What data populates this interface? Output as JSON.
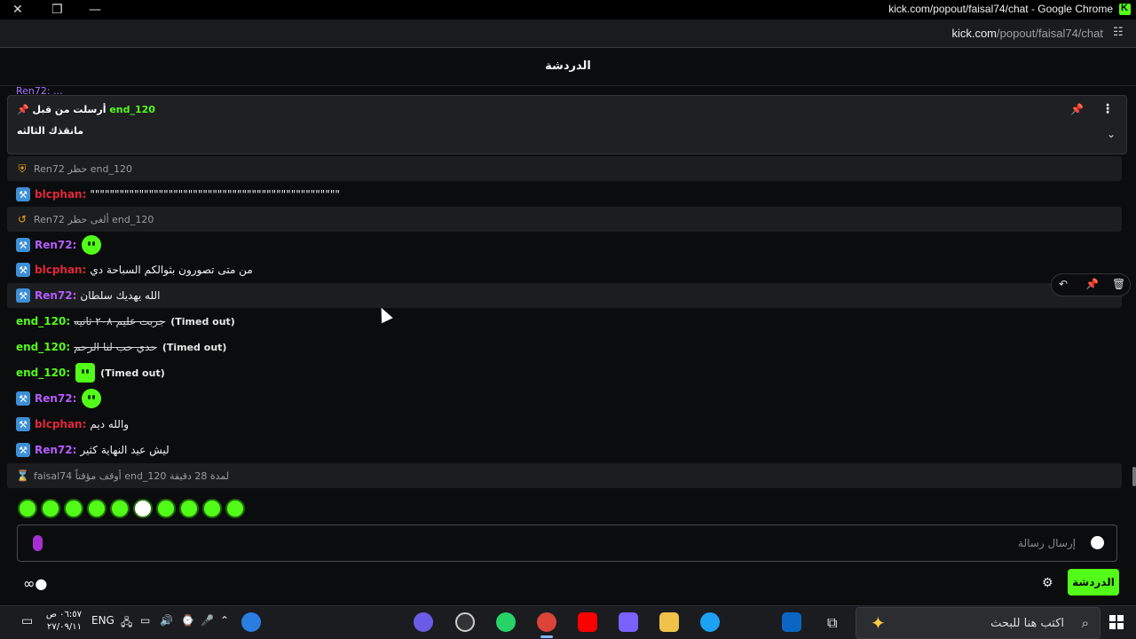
{
  "window": {
    "title": "kick.com/popout/faisal74/chat - Google Chrome",
    "controls": [
      "✕",
      "❐",
      "—"
    ]
  },
  "urlbar": {
    "host": "kick.com",
    "path": "/popout/faisal74/chat",
    "tune_icon": "☷"
  },
  "chat": {
    "title": "الدردشة",
    "peek": "Ren72: ...",
    "pinned": {
      "label": "أرسلت من قبل",
      "user": "end_120",
      "message": "مانقذك الثالثه",
      "chevron": "⌄",
      "menu": "⋮",
      "pin": "📌"
    },
    "messages": [
      {
        "user": "",
        "text": "",
        "sys": "Ren72 حظر end_120"
      },
      {
        "user": "blcphan:",
        "text": "\"\"\"\"\"\"\"\"\"\"\"\"\"\"\"\"\"\"\"\"\"\"\"\"\"\"\"\"\"\"\"\"\"\"\"\"\"\"\"\"\"\"\"\"\"\"\"\"\"\"\""
      },
      {
        "user": "",
        "text": "",
        "sys": "Ren72 ألغى حظر end_120"
      },
      {
        "user": "Ren72:",
        "text": ""
      },
      {
        "user": "blcphan:",
        "text": "من متى تصورون بثوالكم السباحة دي"
      },
      {
        "user": "Ren72:",
        "text": "الله يهديك سلطان"
      },
      {
        "user": "end_120:",
        "text": "جربت عليم ٢٠٨ ثانيه",
        "status": "(Timed out)"
      },
      {
        "user": "end_120:",
        "text": "حدي حب لنا الرحم",
        "status": "(Timed out)"
      },
      {
        "user": "end_120:",
        "text": "",
        "status": "(Timed out)"
      },
      {
        "user": "Ren72:",
        "text": ""
      },
      {
        "user": "blcphan:",
        "text": "والله ديم"
      },
      {
        "user": "Ren72:",
        "text": "ليش عيد النهاية كثير"
      },
      {
        "user": "",
        "text": "",
        "sys": "faisal74 أوقف مؤقتاً end_120 لمدة 28 دقيقة"
      }
    ],
    "hover_tools": [
      "↶",
      "📌",
      "🗑"
    ],
    "input_placeholder": "إرسال رسالة",
    "send_label": "الدردشة",
    "footer_icon": "∞●"
  },
  "taskbar": {
    "clock_time": "٠٦:٥٧ ص",
    "clock_date": "٢٧/٠٩/١١",
    "lang": "ENG",
    "search_text": "اكتب هنا للبحث",
    "search_icon": "⌕"
  },
  "colors": {
    "accent": "#53fc18",
    "ren": "#b55cff",
    "blc": "#e0263a",
    "bg": "#0b0c0d"
  }
}
